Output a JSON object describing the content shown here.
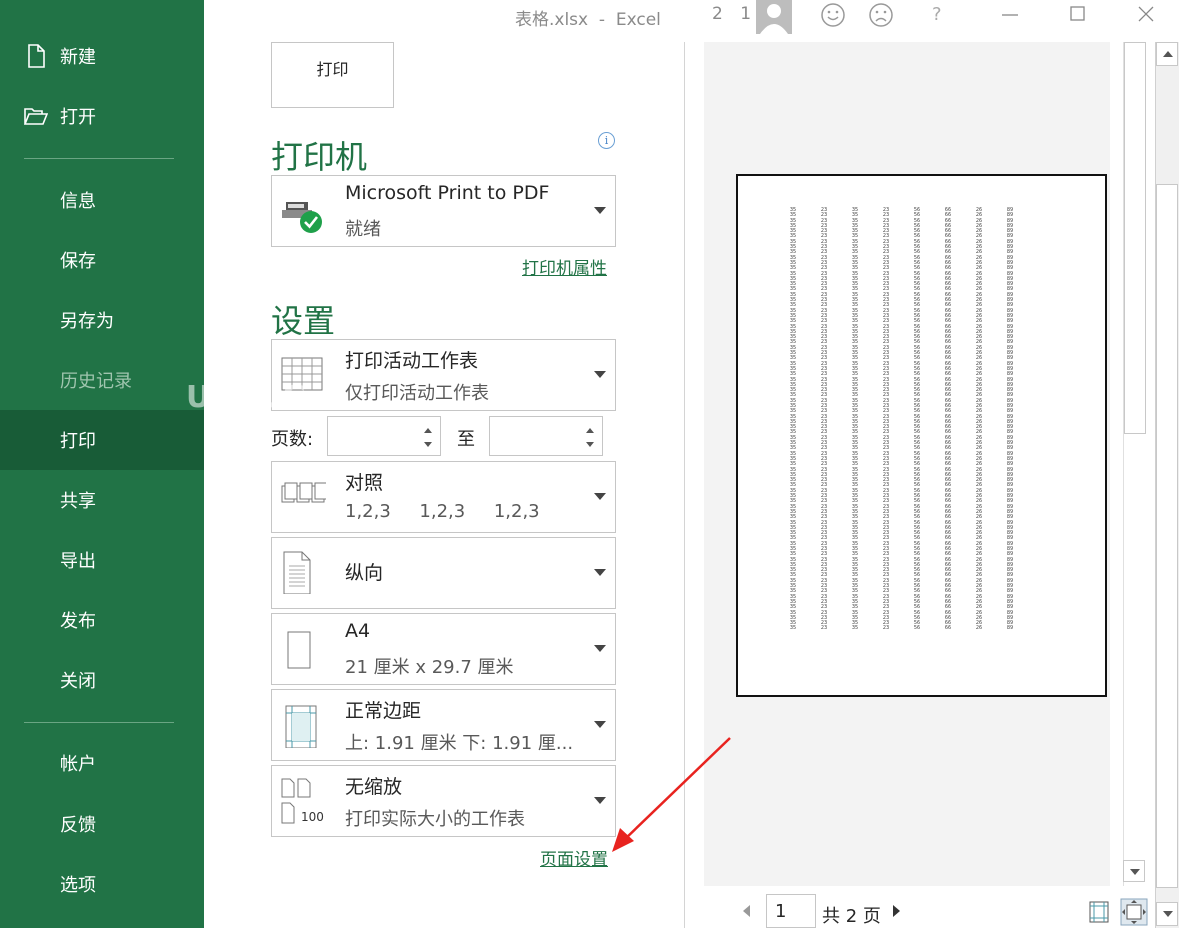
{
  "window": {
    "title": "表格.xlsx  -  Excel",
    "counter": "2 1"
  },
  "nav": {
    "items": [
      {
        "label": "新建",
        "icon": "new-file-icon"
      },
      {
        "label": "打开",
        "icon": "open-folder-icon"
      },
      {
        "label": "信息"
      },
      {
        "label": "保存"
      },
      {
        "label": "另存为"
      },
      {
        "label": "历史记录",
        "disabled": true
      },
      {
        "label": "打印",
        "active": true
      },
      {
        "label": "共享"
      },
      {
        "label": "导出"
      },
      {
        "label": "发布"
      },
      {
        "label": "关闭"
      },
      {
        "label": "帐户"
      },
      {
        "label": "反馈"
      },
      {
        "label": "选项"
      }
    ],
    "watermark": "UEBUG"
  },
  "print": {
    "button_label": "打印",
    "printer_title": "打印机",
    "printer": {
      "name": "Microsoft Print to PDF",
      "status": "就绪"
    },
    "printer_props_link": "打印机属性",
    "settings_title": "设置",
    "options": [
      {
        "line1": "打印活动工作表",
        "line2": "仅打印活动工作表"
      },
      {
        "line1": "对照",
        "line2": "1,2,3     1,2,3     1,2,3"
      },
      {
        "line1": "纵向",
        "line2": ""
      },
      {
        "line1": "A4",
        "line2": "21 厘米 x 29.7 厘米"
      },
      {
        "line1": "正常边距",
        "line2": "上: 1.91 厘米 下: 1.91 厘..."
      },
      {
        "line1": "无缩放",
        "line2": "打印实际大小的工作表"
      }
    ],
    "pages_label": "页数:",
    "to_label": "至",
    "page_from": "",
    "page_to": "",
    "page_setup_link": "页面设置",
    "scaling_icon_text": "100"
  },
  "preview": {
    "columns": [
      "35",
      "23",
      "35",
      "23",
      "56",
      "66",
      "26",
      "89"
    ],
    "rows_per_column": 80
  },
  "pager": {
    "current_page": "1",
    "total_label": "共 2 页"
  },
  "colors": {
    "brand_green": "#217346",
    "active_green": "#185c37",
    "arrow_red": "#e8231f"
  }
}
